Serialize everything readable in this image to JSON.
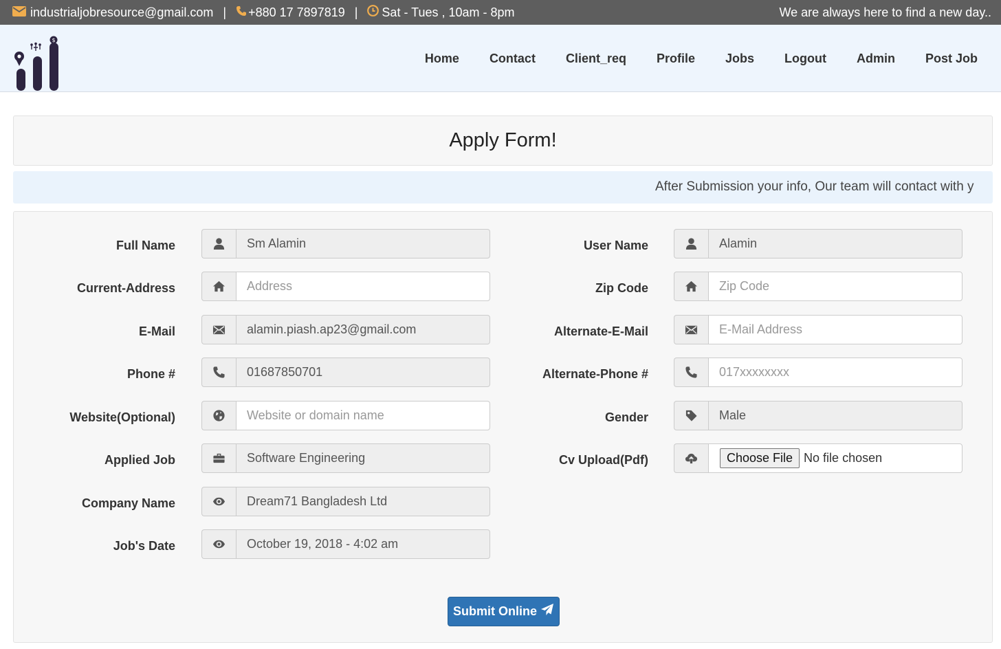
{
  "topbar": {
    "email": "industrialjobresource@gmail.com",
    "phone": "+880 17 7897819",
    "hours": "Sat - Tues , 10am - 8pm",
    "separator": "|",
    "tagline": "We are always here to find a new day..",
    "accent_color": "#f0ad4e"
  },
  "nav": {
    "items": [
      "Home",
      "Contact",
      "Client_req",
      "Profile",
      "Jobs",
      "Logout",
      "Admin",
      "Post Job"
    ]
  },
  "form": {
    "title": "Apply Form!",
    "notice": "After Submission your info, Our team will contact with y",
    "fields": {
      "full_name": {
        "label": "Full Name",
        "value": "Sm Alamin",
        "icon": "user-icon"
      },
      "current_address": {
        "label": "Current-Address",
        "placeholder": "Address",
        "icon": "home-icon"
      },
      "email": {
        "label": "E-Mail",
        "value": "alamin.piash.ap23@gmail.com",
        "icon": "envelope-icon"
      },
      "phone": {
        "label": "Phone #",
        "value": "01687850701",
        "icon": "phone-icon"
      },
      "website": {
        "label": "Website(Optional)",
        "placeholder": "Website or domain name",
        "icon": "globe-icon"
      },
      "applied_job": {
        "label": "Applied Job",
        "value": "Software Engineering",
        "icon": "briefcase-icon"
      },
      "company_name": {
        "label": "Company Name",
        "value": "Dream71 Bangladesh Ltd",
        "icon": "eye-icon"
      },
      "jobs_date": {
        "label": "Job's Date",
        "value": "October 19, 2018 - 4:02 am",
        "icon": "eye-icon"
      },
      "user_name": {
        "label": "User Name",
        "value": "Alamin",
        "icon": "user-icon"
      },
      "zip_code": {
        "label": "Zip Code",
        "placeholder": "Zip Code",
        "icon": "home-icon"
      },
      "alternate_email": {
        "label": "Alternate-E-Mail",
        "placeholder": "E-Mail Address",
        "icon": "envelope-icon"
      },
      "alternate_phone": {
        "label": "Alternate-Phone #",
        "placeholder": "017xxxxxxxx",
        "icon": "phone-icon"
      },
      "gender": {
        "label": "Gender",
        "value": "Male",
        "icon": "tag-icon"
      },
      "cv_upload": {
        "label": "Cv Upload(Pdf)",
        "button": "Choose File",
        "status": "No file chosen",
        "icon": "cloud-upload-icon"
      }
    },
    "submit_label": "Submit Online",
    "submit_icon": "paper-plane-icon",
    "submit_color": "#2f74b5"
  }
}
